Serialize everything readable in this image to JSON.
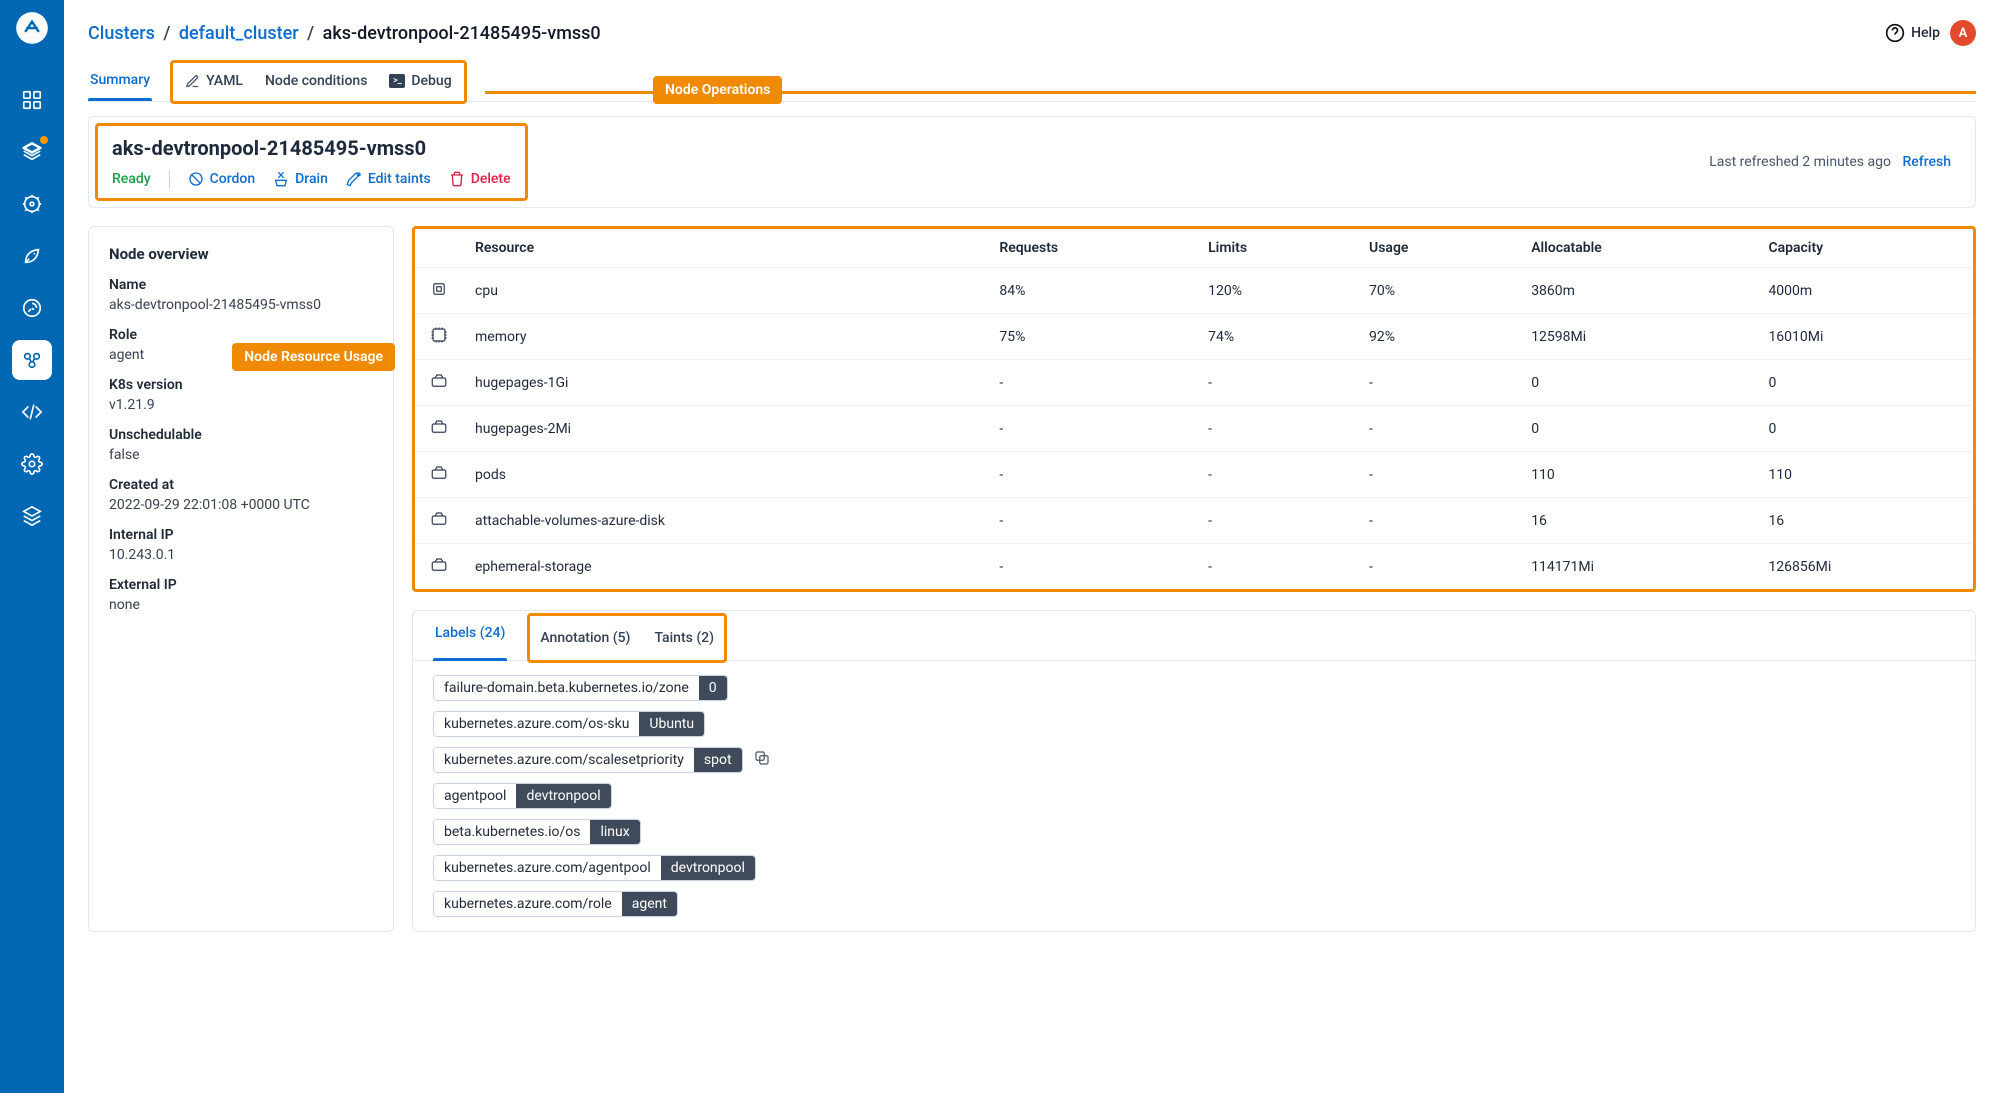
{
  "breadcrumbs": {
    "root": "Clusters",
    "cluster": "default_cluster",
    "node": "aks-devtronpool-21485495-vmss0"
  },
  "topRight": {
    "help": "Help",
    "avatarInitial": "A"
  },
  "tabs": {
    "summary": "Summary",
    "yaml": "YAML",
    "conditions": "Node conditions",
    "debug": "Debug"
  },
  "callouts": {
    "nodeOps": "Node Operations",
    "resourceUsage": "Node Resource Usage"
  },
  "header": {
    "title": "aks-devtronpool-21485495-vmss0",
    "status": "Ready",
    "actions": {
      "cordon": "Cordon",
      "drain": "Drain",
      "editTaints": "Edit taints",
      "delete": "Delete"
    },
    "lastRefreshed": "Last refreshed 2 minutes ago",
    "refresh": "Refresh"
  },
  "overview": {
    "title": "Node overview",
    "items": [
      {
        "label": "Name",
        "value": "aks-devtronpool-21485495-vmss0"
      },
      {
        "label": "Role",
        "value": "agent"
      },
      {
        "label": "K8s version",
        "value": "v1.21.9"
      },
      {
        "label": "Unschedulable",
        "value": "false"
      },
      {
        "label": "Created at",
        "value": "2022-09-29 22:01:08 +0000 UTC"
      },
      {
        "label": "Internal IP",
        "value": "10.243.0.1"
      },
      {
        "label": "External IP",
        "value": "none"
      }
    ]
  },
  "resources": {
    "headers": [
      "Resource",
      "Requests",
      "Limits",
      "Usage",
      "Allocatable",
      "Capacity"
    ],
    "rows": [
      {
        "icon": "cpu",
        "name": "cpu",
        "requests": "84%",
        "limits": "120%",
        "usage": "70%",
        "allocatable": "3860m",
        "capacity": "4000m"
      },
      {
        "icon": "mem",
        "name": "memory",
        "requests": "75%",
        "limits": "74%",
        "usage": "92%",
        "allocatable": "12598Mi",
        "capacity": "16010Mi"
      },
      {
        "icon": "disk",
        "name": "hugepages-1Gi",
        "requests": "-",
        "limits": "-",
        "usage": "-",
        "allocatable": "0",
        "capacity": "0"
      },
      {
        "icon": "disk",
        "name": "hugepages-2Mi",
        "requests": "-",
        "limits": "-",
        "usage": "-",
        "allocatable": "0",
        "capacity": "0"
      },
      {
        "icon": "disk",
        "name": "pods",
        "requests": "-",
        "limits": "-",
        "usage": "-",
        "allocatable": "110",
        "capacity": "110"
      },
      {
        "icon": "disk",
        "name": "attachable-volumes-azure-disk",
        "requests": "-",
        "limits": "-",
        "usage": "-",
        "allocatable": "16",
        "capacity": "16"
      },
      {
        "icon": "disk",
        "name": "ephemeral-storage",
        "requests": "-",
        "limits": "-",
        "usage": "-",
        "allocatable": "114171Mi",
        "capacity": "126856Mi"
      }
    ]
  },
  "metaTabs": {
    "labels": "Labels (24)",
    "annotations": "Annotation (5)",
    "taints": "Taints (2)"
  },
  "labels": [
    {
      "key": "failure-domain.beta.kubernetes.io/zone",
      "val": "0"
    },
    {
      "key": "kubernetes.azure.com/os-sku",
      "val": "Ubuntu"
    },
    {
      "key": "kubernetes.azure.com/scalesetpriority",
      "val": "spot",
      "copy": true
    },
    {
      "key": "agentpool",
      "val": "devtronpool"
    },
    {
      "key": "beta.kubernetes.io/os",
      "val": "linux"
    },
    {
      "key": "kubernetes.azure.com/agentpool",
      "val": "devtronpool"
    },
    {
      "key": "kubernetes.azure.com/role",
      "val": "agent"
    }
  ]
}
